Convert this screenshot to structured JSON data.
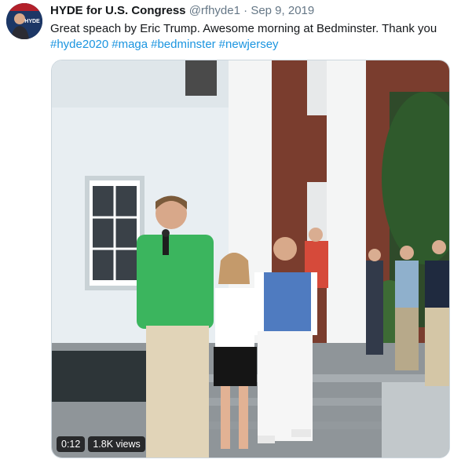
{
  "tweet": {
    "author_name": "HYDE for U.S. Congress",
    "handle": "@rfhyde1",
    "separator": "·",
    "date": "Sep 9, 2019",
    "text": "Great speach by Eric Trump. Awesome morning at Bedminster. Thank you",
    "hashtags": [
      "#hyde2020",
      "#maga",
      "#bedminster",
      "#newjersey"
    ],
    "avatar_text": "HYDE"
  },
  "video": {
    "duration": "0:12",
    "views": "1.8K views"
  },
  "colors": {
    "link": "#1b95e0",
    "text": "#14171a",
    "muted": "#657786"
  }
}
